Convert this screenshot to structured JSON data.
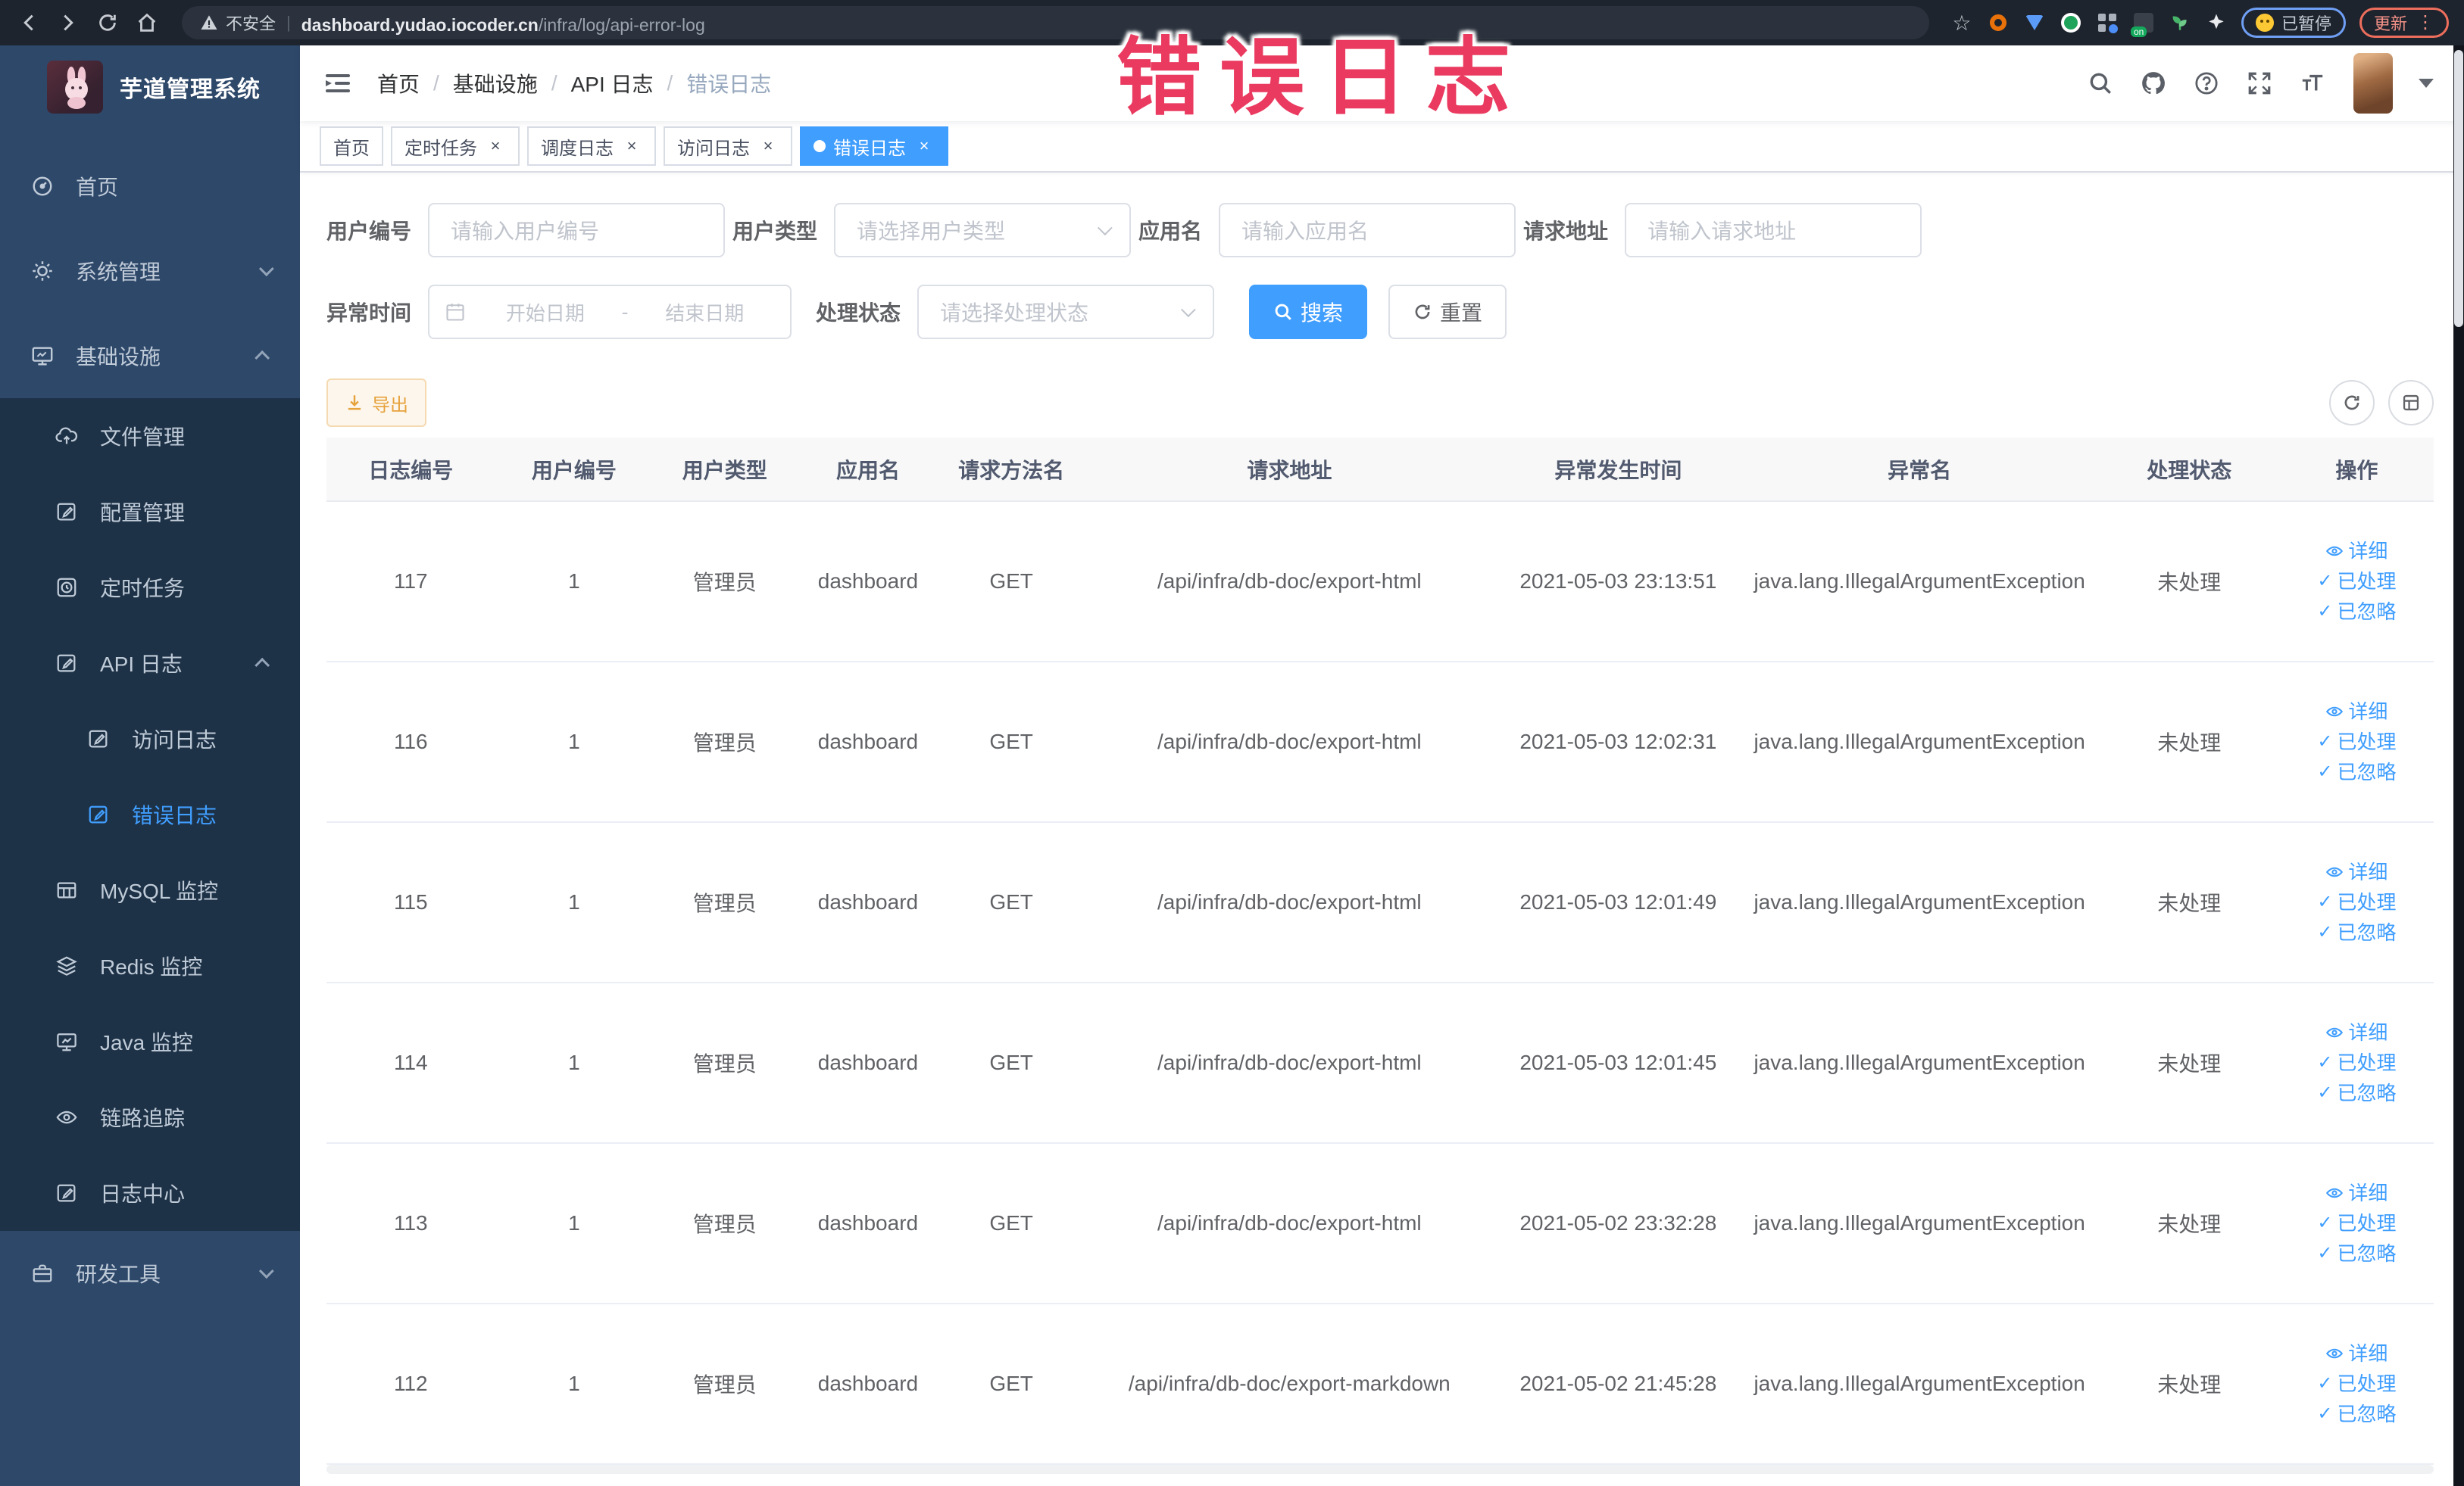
{
  "annotation": {
    "text": "错误日志"
  },
  "browser": {
    "security_label": "不安全",
    "url_host": "dashboard.yudao.iocoder.cn",
    "url_path": "/infra/log/api-error-log",
    "paused_label": "已暂停",
    "update_label": "更新",
    "on_badge": "on"
  },
  "sidebar": {
    "logo_title": "芋道管理系统",
    "menu": [
      {
        "name": "home",
        "label": "首页",
        "icon": "gauge",
        "level": 1,
        "sub": false
      },
      {
        "name": "system-mgmt",
        "label": "系统管理",
        "icon": "gear",
        "level": 1,
        "sub": false,
        "arrow": "down"
      },
      {
        "name": "infrastructure",
        "label": "基础设施",
        "icon": "monitor",
        "level": 1,
        "sub": false,
        "arrow": "up"
      },
      {
        "name": "file-mgmt",
        "label": "文件管理",
        "icon": "upload",
        "level": 2,
        "sub": true
      },
      {
        "name": "config-mgmt",
        "label": "配置管理",
        "icon": "edit",
        "level": 2,
        "sub": true
      },
      {
        "name": "cron-job",
        "label": "定时任务",
        "icon": "clock",
        "level": 2,
        "sub": true
      },
      {
        "name": "api-log",
        "label": "API 日志",
        "icon": "edit",
        "level": 2,
        "sub": true,
        "arrow": "up"
      },
      {
        "name": "access-log",
        "label": "访问日志",
        "icon": "edit",
        "level": 3,
        "sub": true
      },
      {
        "name": "error-log",
        "label": "错误日志",
        "icon": "edit",
        "level": 3,
        "sub": true,
        "active": true
      },
      {
        "name": "mysql-monitor",
        "label": "MySQL 监控",
        "icon": "db",
        "level": 2,
        "sub": true
      },
      {
        "name": "redis-monitor",
        "label": "Redis 监控",
        "icon": "layers",
        "level": 2,
        "sub": true
      },
      {
        "name": "java-monitor",
        "label": "Java 监控",
        "icon": "screen",
        "level": 2,
        "sub": true
      },
      {
        "name": "trace",
        "label": "链路追踪",
        "icon": "eye",
        "level": 2,
        "sub": true
      },
      {
        "name": "log-center",
        "label": "日志中心",
        "icon": "edit",
        "level": 2,
        "sub": true
      },
      {
        "name": "dev-tools",
        "label": "研发工具",
        "icon": "tool",
        "level": 1,
        "sub": false,
        "arrow": "down"
      }
    ]
  },
  "header": {
    "breadcrumb": [
      "首页",
      "基础设施",
      "API 日志",
      "错误日志"
    ]
  },
  "tabs": [
    {
      "name": "home",
      "label": "首页",
      "closable": false,
      "active": false
    },
    {
      "name": "cron-job",
      "label": "定时任务",
      "closable": true,
      "active": false
    },
    {
      "name": "job-log",
      "label": "调度日志",
      "closable": true,
      "active": false
    },
    {
      "name": "access-log",
      "label": "访问日志",
      "closable": true,
      "active": false
    },
    {
      "name": "error-log",
      "label": "错误日志",
      "closable": true,
      "active": true
    }
  ],
  "filters": {
    "user_id": {
      "label": "用户编号",
      "placeholder": "请输入用户编号"
    },
    "user_type": {
      "label": "用户类型",
      "placeholder": "请选择用户类型"
    },
    "app_name": {
      "label": "应用名",
      "placeholder": "请输入应用名"
    },
    "request_url": {
      "label": "请求地址",
      "placeholder": "请输入请求地址"
    },
    "exception_time": {
      "label": "异常时间",
      "start_placeholder": "开始日期",
      "separator": "-",
      "end_placeholder": "结束日期"
    },
    "process_status": {
      "label": "处理状态",
      "placeholder": "请选择处理状态"
    },
    "search_label": "搜索",
    "reset_label": "重置"
  },
  "toolbar": {
    "export_label": "导出"
  },
  "table": {
    "columns": [
      "日志编号",
      "用户编号",
      "用户类型",
      "应用名",
      "请求方法名",
      "请求地址",
      "异常发生时间",
      "异常名",
      "处理状态",
      "操作"
    ],
    "actions": [
      "详细",
      "已处理",
      "已忽略"
    ],
    "rows": [
      {
        "id": "117",
        "user_id": "1",
        "user_type": "管理员",
        "app_name": "dashboard",
        "method": "GET",
        "url": "/api/infra/db-doc/export-html",
        "time": "2021-05-03 23:13:51",
        "exception": "java.lang.IllegalArgumentException",
        "status": "未处理"
      },
      {
        "id": "116",
        "user_id": "1",
        "user_type": "管理员",
        "app_name": "dashboard",
        "method": "GET",
        "url": "/api/infra/db-doc/export-html",
        "time": "2021-05-03 12:02:31",
        "exception": "java.lang.IllegalArgumentException",
        "status": "未处理"
      },
      {
        "id": "115",
        "user_id": "1",
        "user_type": "管理员",
        "app_name": "dashboard",
        "method": "GET",
        "url": "/api/infra/db-doc/export-html",
        "time": "2021-05-03 12:01:49",
        "exception": "java.lang.IllegalArgumentException",
        "status": "未处理"
      },
      {
        "id": "114",
        "user_id": "1",
        "user_type": "管理员",
        "app_name": "dashboard",
        "method": "GET",
        "url": "/api/infra/db-doc/export-html",
        "time": "2021-05-03 12:01:45",
        "exception": "java.lang.IllegalArgumentException",
        "status": "未处理"
      },
      {
        "id": "113",
        "user_id": "1",
        "user_type": "管理员",
        "app_name": "dashboard",
        "method": "GET",
        "url": "/api/infra/db-doc/export-html",
        "time": "2021-05-02 23:32:28",
        "exception": "java.lang.IllegalArgumentException",
        "status": "未处理"
      },
      {
        "id": "112",
        "user_id": "1",
        "user_type": "管理员",
        "app_name": "dashboard",
        "method": "GET",
        "url": "/api/infra/db-doc/export-markdown",
        "time": "2021-05-02 21:45:28",
        "exception": "java.lang.IllegalArgumentException",
        "status": "未处理"
      }
    ]
  }
}
